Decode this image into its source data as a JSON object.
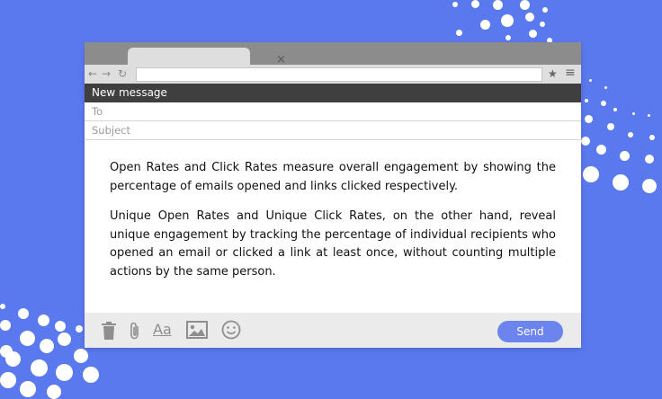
{
  "window": {
    "tab_close": "×",
    "nav": {
      "back": "←",
      "forward": "→",
      "reload": "↻"
    },
    "toolbar": {
      "star": "★",
      "menu": "≡"
    }
  },
  "compose": {
    "header": "New message",
    "to_placeholder": "To",
    "subject_placeholder": "Subject",
    "paragraphs": [
      "Open Rates and Click Rates measure overall engagement by showing the percentage of emails opened and links clicked respectively.",
      "Unique Open Rates and Unique Click Rates, on the other hand, reveal unique engagement by tracking the percentage of individual recipients who opened an email or clicked a link at least once, without counting multiple actions by the same person."
    ],
    "footer": {
      "icons": [
        "trash-icon",
        "paperclip-icon",
        "text-format-icon",
        "image-icon",
        "emoji-icon"
      ],
      "format_label": "Aa",
      "send_label": "Send"
    }
  },
  "colors": {
    "background": "#5b79ee",
    "header": "#3f3f3f",
    "send_button": "#6b84ee"
  }
}
